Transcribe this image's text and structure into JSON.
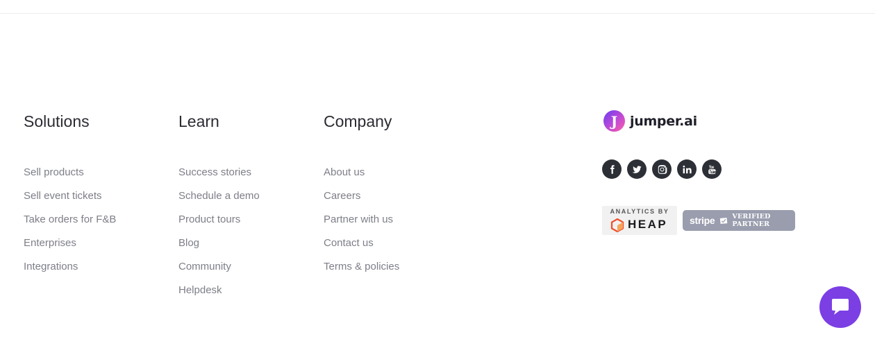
{
  "footer": {
    "solutions": {
      "heading": "Solutions",
      "items": [
        "Sell products",
        "Sell event tickets",
        "Take orders for F&B",
        "Enterprises",
        "Integrations"
      ]
    },
    "learn": {
      "heading": "Learn",
      "items": [
        "Success stories",
        "Schedule a demo",
        "Product tours",
        "Blog",
        "Community",
        "Helpdesk"
      ]
    },
    "company": {
      "heading": "Company",
      "items": [
        "About us",
        "Careers",
        "Partner with us",
        "Contact us",
        "Terms & policies"
      ]
    },
    "brand": {
      "logo_letter": "J",
      "name": "jumper.ai"
    },
    "socials": [
      "facebook-icon",
      "twitter-icon",
      "instagram-icon",
      "linkedin-icon",
      "youtube-icon"
    ],
    "badges": {
      "heap_top": "ANALYTICS BY",
      "heap_word": "HEAP",
      "stripe_word": "stripe",
      "stripe_verified": "VERIFIED PARTNER"
    },
    "colors": {
      "chat_bubble": "#7b3fe4",
      "social_bg": "#2d2f36",
      "stripe_badge": "#9a9dae"
    }
  }
}
